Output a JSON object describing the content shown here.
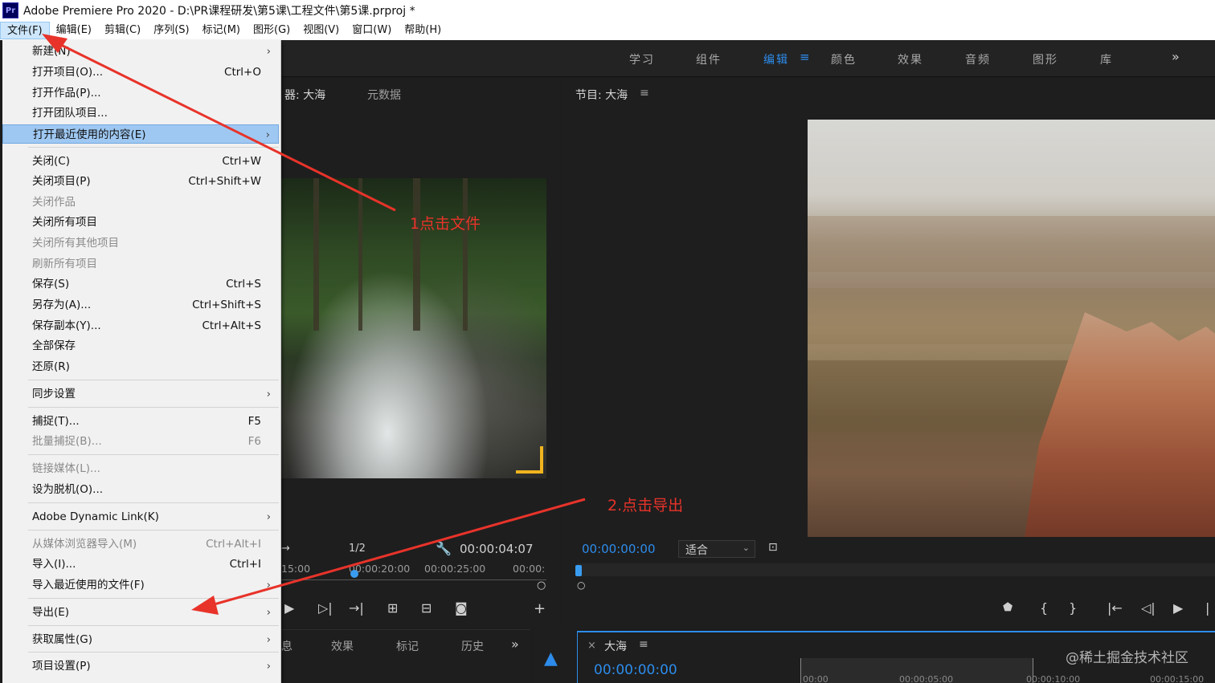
{
  "window": {
    "title": "Adobe Premiere Pro 2020 - D:\\PR课程研发\\第5课\\工程文件\\第5课.prproj *",
    "logo": "Pr"
  },
  "menubar": [
    "文件(F)",
    "编辑(E)",
    "剪辑(C)",
    "序列(S)",
    "标记(M)",
    "图形(G)",
    "视图(V)",
    "窗口(W)",
    "帮助(H)"
  ],
  "workspaces": {
    "tabs": [
      "学习",
      "组件",
      "编辑",
      "颜色",
      "效果",
      "音频",
      "图形",
      "库"
    ],
    "active": "编辑",
    "more": "»",
    "menu_icon": "≡"
  },
  "file_menu": {
    "items": [
      {
        "label": "新建(N)",
        "submenu": true
      },
      {
        "label": "打开项目(O)...",
        "shortcut": "Ctrl+O"
      },
      {
        "label": "打开作品(P)..."
      },
      {
        "label": "打开团队项目..."
      },
      {
        "label": "打开最近使用的内容(E)",
        "submenu": true,
        "highlighted": true
      },
      {
        "label": "关闭(C)",
        "shortcut": "Ctrl+W"
      },
      {
        "label": "关闭项目(P)",
        "shortcut": "Ctrl+Shift+W"
      },
      {
        "label": "关闭作品",
        "disabled": true
      },
      {
        "label": "关闭所有项目"
      },
      {
        "label": "关闭所有其他项目",
        "disabled": true
      },
      {
        "label": "刷新所有项目",
        "disabled": true
      },
      {
        "label": "保存(S)",
        "shortcut": "Ctrl+S"
      },
      {
        "label": "另存为(A)...",
        "shortcut": "Ctrl+Shift+S"
      },
      {
        "label": "保存副本(Y)...",
        "shortcut": "Ctrl+Alt+S"
      },
      {
        "label": "全部保存"
      },
      {
        "label": "还原(R)"
      },
      {
        "label": "同步设置",
        "submenu": true
      },
      {
        "label": "捕捉(T)...",
        "shortcut": "F5"
      },
      {
        "label": "批量捕捉(B)...",
        "shortcut": "F6",
        "disabled": true
      },
      {
        "label": "链接媒体(L)...",
        "disabled": true
      },
      {
        "label": "设为脱机(O)..."
      },
      {
        "label": "Adobe Dynamic Link(K)",
        "submenu": true
      },
      {
        "label": "从媒体浏览器导入(M)",
        "shortcut": "Ctrl+Alt+I",
        "disabled": true
      },
      {
        "label": "导入(I)...",
        "shortcut": "Ctrl+I"
      },
      {
        "label": "导入最近使用的文件(F)",
        "submenu": true
      },
      {
        "label": "导出(E)",
        "submenu": true
      },
      {
        "label": "获取属性(G)",
        "submenu": true
      },
      {
        "label": "项目设置(P)",
        "submenu": true
      }
    ]
  },
  "source_panel": {
    "tabs": [
      "器: 大海",
      "元数据"
    ],
    "resolution": "1/2",
    "timecode": "00:00:04:07",
    "ruler": [
      "15:00",
      "00:00:20:00",
      "00:00:25:00",
      "00:00:"
    ]
  },
  "program_panel": {
    "title": "节目: 大海",
    "menu_icon": "≡",
    "timecode": "00:00:00:00",
    "fit": "适合"
  },
  "bottom_panel": {
    "tabs": [
      "息",
      "效果",
      "标记",
      "历史"
    ],
    "more": "»"
  },
  "timeline": {
    "title": "大海",
    "close": "×",
    "menu_icon": "≡",
    "timecode": "00:00:00:00",
    "ruler": [
      "00:00",
      "00:00:05:00",
      "00:00:10:00",
      "00:00:15:00"
    ]
  },
  "annotations": {
    "step1": "1点击文件",
    "step2": "2.点击导出"
  },
  "watermark": "@稀土掘金技术社区",
  "colors": {
    "accent": "#2d8ceb",
    "annotation": "#e8332a",
    "menu_highlight": "#9ec8f2"
  }
}
